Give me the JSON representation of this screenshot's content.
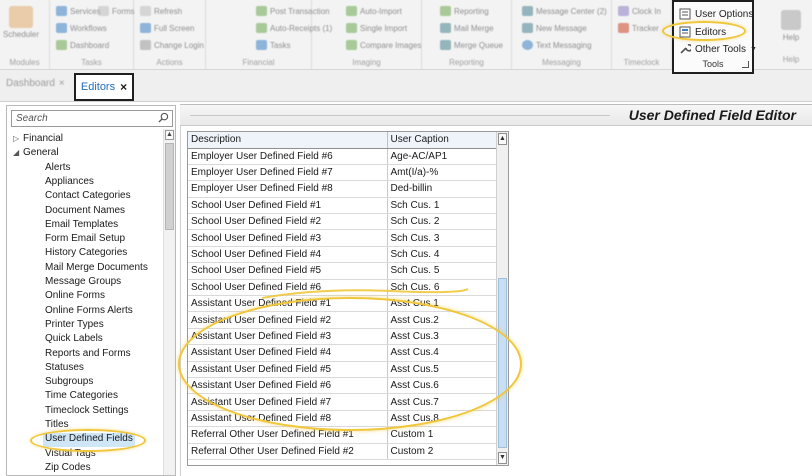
{
  "ribbon": {
    "scheduler_label": "Scheduler",
    "groups": [
      {
        "label": "Modules",
        "items": []
      },
      {
        "label": "Tasks",
        "items": [
          "Services",
          "Forms",
          "Workflows",
          "Dashboard"
        ]
      },
      {
        "label": "Actions",
        "items": [
          "Refresh",
          "Full Screen",
          "Change Login"
        ]
      },
      {
        "label": "Financial",
        "items": [
          "Post Transaction",
          "Auto-Receipts (1)",
          "Tasks"
        ]
      },
      {
        "label": "Imaging",
        "items": [
          "Auto-Import",
          "Single Import",
          "Compare Images"
        ]
      },
      {
        "label": "Reporting",
        "items": [
          "Reporting",
          "Mail Merge",
          "Merge Queue"
        ]
      },
      {
        "label": "Messaging",
        "items": [
          "Message Center (2)",
          "New Message",
          "Text Messaging"
        ]
      },
      {
        "label": "Timeclock",
        "items": [
          "Clock In",
          "Tracker"
        ]
      }
    ],
    "tools": {
      "label": "Tools",
      "items": [
        "User Options",
        "Editors",
        "Other Tools"
      ]
    },
    "help": {
      "button_label": "Help",
      "group_label": "Help"
    },
    "icon_colors": [
      "#3b7fc4",
      "#6aa84f",
      "#e69138",
      "#cc4125",
      "#8e7cc3",
      "#45818e"
    ]
  },
  "tabs": [
    {
      "label": "Dashboard",
      "closable": true
    },
    {
      "label": "Editors",
      "closable": true
    }
  ],
  "left": {
    "search_placeholder": "Search",
    "tree": [
      {
        "label": "Financial",
        "level": 0,
        "expanded": false
      },
      {
        "label": "General",
        "level": 0,
        "expanded": true
      },
      {
        "label": "Alerts",
        "level": 1
      },
      {
        "label": "Appliances",
        "level": 1
      },
      {
        "label": "Contact Categories",
        "level": 1
      },
      {
        "label": "Document Names",
        "level": 1
      },
      {
        "label": "Email Templates",
        "level": 1
      },
      {
        "label": "Form Email Setup",
        "level": 1
      },
      {
        "label": "History Categories",
        "level": 1
      },
      {
        "label": "Mail Merge Documents",
        "level": 1
      },
      {
        "label": "Message Groups",
        "level": 1
      },
      {
        "label": "Online Forms",
        "level": 1
      },
      {
        "label": "Online Forms Alerts",
        "level": 1
      },
      {
        "label": "Printer Types",
        "level": 1
      },
      {
        "label": "Quick Labels",
        "level": 1
      },
      {
        "label": "Reports and Forms",
        "level": 1
      },
      {
        "label": "Statuses",
        "level": 1
      },
      {
        "label": "Subgroups",
        "level": 1
      },
      {
        "label": "Time Categories",
        "level": 1
      },
      {
        "label": "Timeclock Settings",
        "level": 1
      },
      {
        "label": "Titles",
        "level": 1
      },
      {
        "label": "User Defined Fields",
        "level": 1,
        "selected": true
      },
      {
        "label": "Visual Tags",
        "level": 1
      },
      {
        "label": "Zip Codes",
        "level": 1
      }
    ]
  },
  "main": {
    "title": "User Defined Field Editor",
    "columns": [
      "Description",
      "User Caption"
    ],
    "rows": [
      [
        "Employer User Defined Field #6",
        "Age-AC/AP1"
      ],
      [
        "Employer User Defined Field #7",
        "Amt(I/a)-%"
      ],
      [
        "Employer User Defined Field #8",
        "Ded-billin"
      ],
      [
        "School User Defined Field #1",
        "Sch Cus. 1"
      ],
      [
        "School User Defined Field #2",
        "Sch Cus. 2"
      ],
      [
        "School User Defined Field #3",
        "Sch Cus. 3"
      ],
      [
        "School User Defined Field #4",
        "Sch Cus. 4"
      ],
      [
        "School User Defined Field #5",
        "Sch Cus. 5"
      ],
      [
        "School User Defined Field #6",
        "Sch Cus. 6"
      ],
      [
        "Assistant User Defined Field #1",
        "Asst Cus.1"
      ],
      [
        "Assistant User Defined Field #2",
        "Asst Cus.2"
      ],
      [
        "Assistant User Defined Field #3",
        "Asst Cus.3"
      ],
      [
        "Assistant User Defined Field #4",
        "Asst Cus.4"
      ],
      [
        "Assistant User Defined Field #5",
        "Asst Cus.5"
      ],
      [
        "Assistant User Defined Field #6",
        "Asst Cus.6"
      ],
      [
        "Assistant User Defined Field #7",
        "Asst Cus.7"
      ],
      [
        "Assistant User Defined Field #8",
        "Asst Cus.8"
      ],
      [
        "Referral Other User Defined Field #1",
        "Custom 1"
      ],
      [
        "Referral Other User Defined Field #2",
        "Custom 2"
      ]
    ]
  },
  "colors": {
    "highlight": "#f0c63a",
    "tab_text": "#1f6fb8",
    "selected_bg": "#cfe6f7"
  }
}
